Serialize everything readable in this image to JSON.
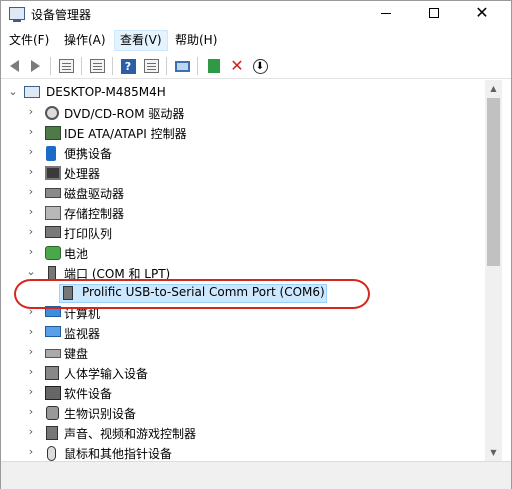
{
  "window": {
    "title": "设备管理器"
  },
  "menu": [
    {
      "label": "文件(F)"
    },
    {
      "label": "操作(A)"
    },
    {
      "label": "查看(V)"
    },
    {
      "label": "帮助(H)"
    }
  ],
  "tree": {
    "root": "DESKTOP-M485M4H",
    "items": [
      {
        "label": "DVD/CD-ROM 驱动器",
        "icon": "disc-drive-icon"
      },
      {
        "label": "IDE ATA/ATAPI 控制器",
        "icon": "ide-controller-icon"
      },
      {
        "label": "便携设备",
        "icon": "portable-device-icon"
      },
      {
        "label": "处理器",
        "icon": "processor-icon"
      },
      {
        "label": "磁盘驱动器",
        "icon": "disk-drive-icon"
      },
      {
        "label": "存储控制器",
        "icon": "storage-controller-icon"
      },
      {
        "label": "打印队列",
        "icon": "printer-icon"
      },
      {
        "label": "电池",
        "icon": "battery-icon"
      },
      {
        "label": "端口 (COM 和 LPT)",
        "icon": "port-icon",
        "expanded": true
      },
      {
        "label": "Prolific USB-to-Serial Comm Port (COM6)",
        "icon": "serial-port-icon",
        "child": true,
        "selected": true
      },
      {
        "label": "计算机",
        "icon": "computer-icon"
      },
      {
        "label": "监视器",
        "icon": "monitor-icon"
      },
      {
        "label": "键盘",
        "icon": "keyboard-icon"
      },
      {
        "label": "人体学输入设备",
        "icon": "hid-icon"
      },
      {
        "label": "软件设备",
        "icon": "software-device-icon"
      },
      {
        "label": "生物识别设备",
        "icon": "biometric-icon"
      },
      {
        "label": "声音、视频和游戏控制器",
        "icon": "sound-icon"
      },
      {
        "label": "鼠标和其他指针设备",
        "icon": "mouse-icon"
      }
    ]
  },
  "colors": {
    "selection": "#cce8ff",
    "annotation": "#d7261d"
  }
}
